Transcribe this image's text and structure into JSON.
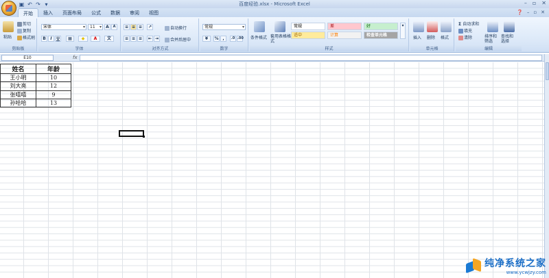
{
  "window": {
    "title": "百度经验.xlsx - Microsoft Excel",
    "qat": [
      "save-icon",
      "undo-icon",
      "redo-icon",
      "customize-icon"
    ],
    "controls": [
      "–",
      "▫",
      "✕"
    ]
  },
  "tabs": [
    "开始",
    "插入",
    "页面布局",
    "公式",
    "数据",
    "审阅",
    "视图"
  ],
  "active_tab": "开始",
  "ribbon": {
    "clipboard": {
      "label": "剪贴板",
      "paste": "粘贴",
      "cut": "剪切",
      "copy": "复制",
      "format_painter": "格式刷"
    },
    "font": {
      "label": "字体",
      "name": "宋体",
      "size": "11",
      "bold": "B",
      "italic": "I",
      "underline": "U",
      "grow": "A",
      "shrink": "A"
    },
    "alignment": {
      "label": "对齐方式",
      "wrap": "自动换行",
      "merge": "合并后居中"
    },
    "number": {
      "label": "数字",
      "format": "常规",
      "percent": "%",
      "comma": ","
    },
    "styles": {
      "label": "样式",
      "cond_format": "条件格式",
      "table_format": "套用表格格式",
      "cells": [
        {
          "text": "常规",
          "bg": "#ffffff",
          "fg": "#000000"
        },
        {
          "text": "差",
          "bg": "#ffc7ce",
          "fg": "#9c0006"
        },
        {
          "text": "好",
          "bg": "#c6efce",
          "fg": "#006100"
        },
        {
          "text": "适中",
          "bg": "#ffeb9c",
          "fg": "#9c6500"
        },
        {
          "text": "计算",
          "bg": "#f2f2f2",
          "fg": "#fa7d00"
        },
        {
          "text": "检查单元格",
          "bg": "#a5a5a5",
          "fg": "#ffffff"
        }
      ]
    },
    "cells": {
      "label": "单元格",
      "insert": "插入",
      "delete": "删除",
      "format": "格式"
    },
    "editing": {
      "label": "编辑",
      "autosum": "自动求和",
      "fill": "填充",
      "clear": "清除",
      "sort": "排序和筛选",
      "find": "查找和选择"
    }
  },
  "formula_bar": {
    "name_box": "E10",
    "fx": "fx",
    "value": ""
  },
  "sheet": {
    "headers": [
      "姓名",
      "年龄"
    ],
    "rows": [
      [
        "王小明",
        "10"
      ],
      [
        "刘大亮",
        "12"
      ],
      [
        "张嘻嘻",
        "9"
      ],
      [
        "孙哈哈",
        "13"
      ]
    ]
  },
  "watermark": {
    "main": "纯净系统之家",
    "sub": "www.ycwjzy.com"
  }
}
